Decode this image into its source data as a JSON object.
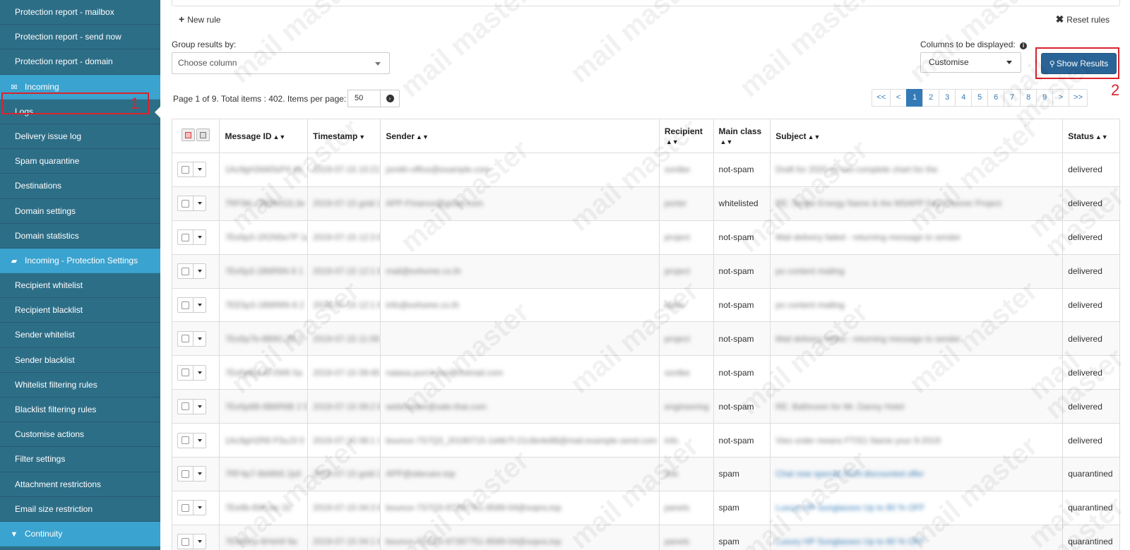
{
  "sidebar": {
    "items": [
      {
        "label": "Protection report - mailbox",
        "type": "item"
      },
      {
        "label": "Protection report - send now",
        "type": "item"
      },
      {
        "label": "Protection report - domain",
        "type": "item"
      },
      {
        "label": "Incoming",
        "type": "section",
        "icon": "envelope-icon"
      },
      {
        "label": "Logs",
        "type": "item",
        "active": true
      },
      {
        "label": "Delivery issue log",
        "type": "item"
      },
      {
        "label": "Spam quarantine",
        "type": "item"
      },
      {
        "label": "Destinations",
        "type": "item"
      },
      {
        "label": "Domain settings",
        "type": "item"
      },
      {
        "label": "Domain statistics",
        "type": "item"
      },
      {
        "label": "Incoming - Protection Settings",
        "type": "section",
        "icon": "folder-open-icon"
      },
      {
        "label": "Recipient whitelist",
        "type": "item"
      },
      {
        "label": "Recipient blacklist",
        "type": "item"
      },
      {
        "label": "Sender whitelist",
        "type": "item"
      },
      {
        "label": "Sender blacklist",
        "type": "item"
      },
      {
        "label": "Whitelist filtering rules",
        "type": "item"
      },
      {
        "label": "Blacklist filtering rules",
        "type": "item"
      },
      {
        "label": "Customise actions",
        "type": "item"
      },
      {
        "label": "Filter settings",
        "type": "item"
      },
      {
        "label": "Attachment restrictions",
        "type": "item"
      },
      {
        "label": "Email size restriction",
        "type": "item"
      },
      {
        "label": "Continuity",
        "type": "section",
        "icon": "filter-icon"
      }
    ]
  },
  "annotations": {
    "step1": "1",
    "step2": "2"
  },
  "toolbar": {
    "new_rule": "New rule",
    "reset_rules": "Reset rules",
    "group_label": "Group results by:",
    "group_placeholder": "Choose column",
    "columns_label": "Columns to be displayed:",
    "columns_value": "Customise",
    "show_results": "Show Results"
  },
  "paging": {
    "summary": "Page 1 of 9. Total items : 402. Items per page:",
    "per_page": "50",
    "pages": [
      "<<",
      "<",
      "1",
      "2",
      "3",
      "4",
      "5",
      "6",
      "7",
      "8",
      "9",
      ">",
      ">>"
    ],
    "current": "1"
  },
  "table": {
    "headers": {
      "message_id": "Message ID",
      "timestamp": "Timestamp",
      "sender": "Sender",
      "recipient": "Recipient",
      "main_class": "Main class",
      "subject": "Subject",
      "status": "Status"
    },
    "rows": [
      {
        "message_id": "1Ac9gH2kM3sP4 d2",
        "timestamp": "2019-07-15 10:21 2",
        "sender": "jsmith-office@example.com",
        "recipient": "sontbe",
        "main_class": "not-spam",
        "subject": "Draft for 2020 do not complete chart for the",
        "status": "delivered"
      },
      {
        "message_id": "7RF0kL-2B9WS2L3e",
        "timestamp": "2019-07-15 gold 1",
        "sender": "APP-Finance@gmail.com",
        "recipient": "porter",
        "main_class": "whitelisted",
        "subject": "RE: Single Energy Name & the MSAPP Day Planner Project",
        "status": "delivered"
      },
      {
        "message_id": "7Ee5p3-1R2N5e7P 1a",
        "timestamp": "2019-07-15 12:3 8",
        "sender": "",
        "recipient": "project",
        "main_class": "not-spam",
        "subject": "Mail delivery failed - returning message to sender",
        "status": "delivered"
      },
      {
        "message_id": "7Ee5p3-1B6R6N 8 1",
        "timestamp": "2019-07-15 12:1 8",
        "sender": "mail@exhome.co.th",
        "recipient": "project",
        "main_class": "not-spam",
        "subject": "po content mailing",
        "status": "delivered"
      },
      {
        "message_id": "7EE5p3-1B6R6N 8 2",
        "timestamp": "2019-07-15 12:1 8",
        "sender": "info@exhome.co.th",
        "recipient": "sales",
        "main_class": "not-spam",
        "subject": "po content mailing",
        "status": "delivered"
      },
      {
        "message_id": "7Ee5p7b-6B9G 2E 1",
        "timestamp": "2019-07-15 11:08 8",
        "sender": "",
        "recipient": "project",
        "main_class": "not-spam",
        "subject": "Mail delivery failed - returning message to sender",
        "status": "delivered"
      },
      {
        "message_id": "7Ee5pRp-6F2W6 5a",
        "timestamp": "2019-07-15 09:45 8",
        "sender": "natasa.purchase@hotmail.com",
        "recipient": "sontbe",
        "main_class": "not-spam",
        "subject": "",
        "status": "delivered"
      },
      {
        "message_id": "7Ee5p6B-6B6R6B 2 5",
        "timestamp": "2019-07-15 09:2 8",
        "sender": "webmaster@sale-thai.com",
        "recipient": "engineering",
        "main_class": "not-spam",
        "subject": "RE: Bathroom for Mr. Danny Hotel",
        "status": "delivered"
      },
      {
        "message_id": "1Ac9gH2R8 P3uJ3 0",
        "timestamp": "2019-07-15 08:1 1",
        "sender": "bounce-7S7Q3_20190715-1d4b7f-21c8e4e88@mail.example-send.com",
        "recipient": "info",
        "main_class": "not-spam",
        "subject": "Vieo order means FTIS1 Name your 9-2019",
        "status": "delivered"
      },
      {
        "message_id": "7RF4p7-6bWb5 2p0",
        "timestamp": "2019-07-15 gold 2",
        "sender": "APP@sitecare.top",
        "recipient": "info",
        "main_class": "spam",
        "subject": "Chat now special 2019 discounted offer",
        "status": "quarantined",
        "subject_link": true
      },
      {
        "message_id": "7Ee9b-6Wl-ee 15",
        "timestamp": "2019-07-15 04:3 8",
        "sender": "bounce-7S7Q3-97397751-8589-04@sopra.top",
        "recipient": "panels",
        "main_class": "spam",
        "subject": "Luxury HP Sunglasses Up to 80 % OFF",
        "status": "quarantined",
        "subject_link": true
      },
      {
        "message_id": "7Ee9bJy-6Hsh9 9a",
        "timestamp": "2019-07-15 04:1 8",
        "sender": "bounce-7S7Q3-97397751-8589-04@sopra.top",
        "recipient": "panels",
        "main_class": "spam",
        "subject": "Luxury HP Sunglasses Up to 80 % OFF",
        "status": "quarantined",
        "subject_link": true
      }
    ]
  },
  "watermark": "mail master",
  "colors": {
    "sidebar_bg": "#2d6e87",
    "section_bg": "#3ba3cf",
    "primary": "#2a6496",
    "link": "#337ab7",
    "annotation": "#d9232d"
  }
}
